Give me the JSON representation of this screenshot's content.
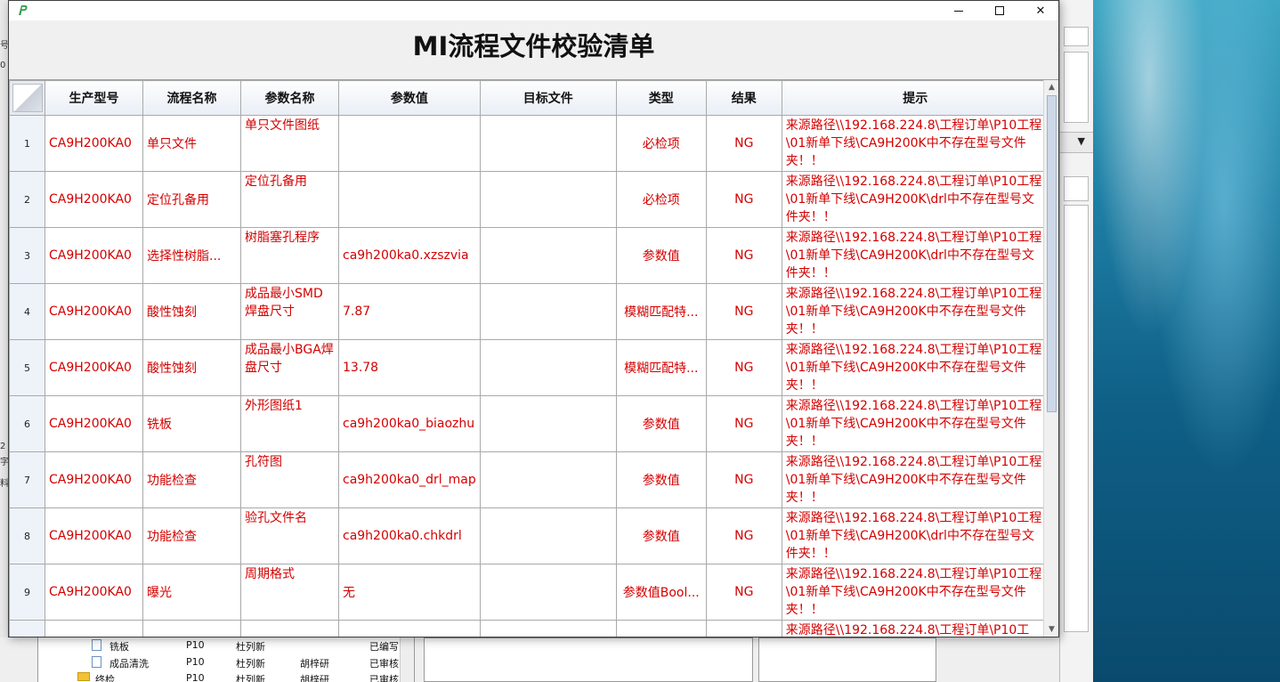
{
  "dialog": {
    "title": "MI流程文件校验清单",
    "window_controls": {
      "minimize": "minimize",
      "maximize": "maximize",
      "close": "✕"
    }
  },
  "grid": {
    "columns": [
      "生产型号",
      "流程名称",
      "参数名称",
      "参数值",
      "目标文件",
      "类型",
      "结果",
      "提示"
    ],
    "rows": [
      {
        "idx": "1",
        "model": "CA9H200KA0",
        "process": "单只文件",
        "param": "单只文件图纸",
        "value": "",
        "target": "",
        "type": "必检项",
        "result": "NG",
        "hint": "来源路径\\\\192.168.224.8\\工程订单\\P10工程\\01新单下线\\CA9H200K中不存在型号文件夹！！"
      },
      {
        "idx": "2",
        "model": "CA9H200KA0",
        "process": "定位孔备用",
        "param": "定位孔备用",
        "value": "",
        "target": "",
        "type": "必检项",
        "result": "NG",
        "hint": "来源路径\\\\192.168.224.8\\工程订单\\P10工程\\01新单下线\\CA9H200K\\drl中不存在型号文件夹！！"
      },
      {
        "idx": "3",
        "model": "CA9H200KA0",
        "process": "选择性树脂...",
        "param": "树脂塞孔程序",
        "value": "ca9h200ka0.xzszvia",
        "target": "",
        "type": "参数值",
        "result": "NG",
        "hint": "来源路径\\\\192.168.224.8\\工程订单\\P10工程\\01新单下线\\CA9H200K\\drl中不存在型号文件夹！！"
      },
      {
        "idx": "4",
        "model": "CA9H200KA0",
        "process": "酸性蚀刻",
        "param": "成品最小SMD焊盘尺寸",
        "value": "7.87",
        "target": "",
        "type": "模糊匹配特...",
        "result": "NG",
        "hint": "来源路径\\\\192.168.224.8\\工程订单\\P10工程\\01新单下线\\CA9H200K中不存在型号文件夹！！"
      },
      {
        "idx": "5",
        "model": "CA9H200KA0",
        "process": "酸性蚀刻",
        "param": "成品最小BGA焊盘尺寸",
        "value": "13.78",
        "target": "",
        "type": "模糊匹配特...",
        "result": "NG",
        "hint": "来源路径\\\\192.168.224.8\\工程订单\\P10工程\\01新单下线\\CA9H200K中不存在型号文件夹！！"
      },
      {
        "idx": "6",
        "model": "CA9H200KA0",
        "process": "铣板",
        "param": "外形图纸1",
        "value": "ca9h200ka0_biaozhu",
        "target": "",
        "type": "参数值",
        "result": "NG",
        "hint": "来源路径\\\\192.168.224.8\\工程订单\\P10工程\\01新单下线\\CA9H200K中不存在型号文件夹！！"
      },
      {
        "idx": "7",
        "model": "CA9H200KA0",
        "process": "功能检查",
        "param": "孔符图",
        "value": "ca9h200ka0_drl_map",
        "target": "",
        "type": "参数值",
        "result": "NG",
        "hint": "来源路径\\\\192.168.224.8\\工程订单\\P10工程\\01新单下线\\CA9H200K中不存在型号文件夹！！"
      },
      {
        "idx": "8",
        "model": "CA9H200KA0",
        "process": "功能检查",
        "param": "验孔文件名",
        "value": "ca9h200ka0.chkdrl",
        "target": "",
        "type": "参数值",
        "result": "NG",
        "hint": "来源路径\\\\192.168.224.8\\工程订单\\P10工程\\01新单下线\\CA9H200K\\drl中不存在型号文件夹！！"
      },
      {
        "idx": "9",
        "model": "CA9H200KA0",
        "process": "曝光",
        "param": "周期格式",
        "value": "无",
        "target": "",
        "type": "参数值Bool...",
        "result": "NG",
        "hint": "来源路径\\\\192.168.224.8\\工程订单\\P10工程\\01新单下线\\CA9H200K中不存在型号文件夹！！"
      },
      {
        "idx": "",
        "model": "",
        "process": "",
        "param": "",
        "value": "",
        "target": "",
        "type": "",
        "result": "",
        "hint": "来源路径\\\\192.168.224.8\\工程订单\\P10工"
      }
    ]
  },
  "background_app": {
    "left_strip": [
      "号",
      "0",
      "2",
      "字",
      "料"
    ],
    "tree_rows": [
      {
        "label": "铣板",
        "code": "P10",
        "user": "杜列新",
        "reviewer": "",
        "status": "已编写"
      },
      {
        "label": "成品清洗",
        "code": "P10",
        "user": "杜列新",
        "reviewer": "胡梓研",
        "status": "已审核"
      },
      {
        "label": "终检",
        "code": "P10",
        "user": "杜列新",
        "reviewer": "胡梓研",
        "status": "已审核"
      }
    ]
  },
  "colors": {
    "data_text": "#d40000",
    "header_bg": "#e9eef6",
    "row_index_bg": "#eef3fa",
    "desktop": "#1d7ea4"
  }
}
